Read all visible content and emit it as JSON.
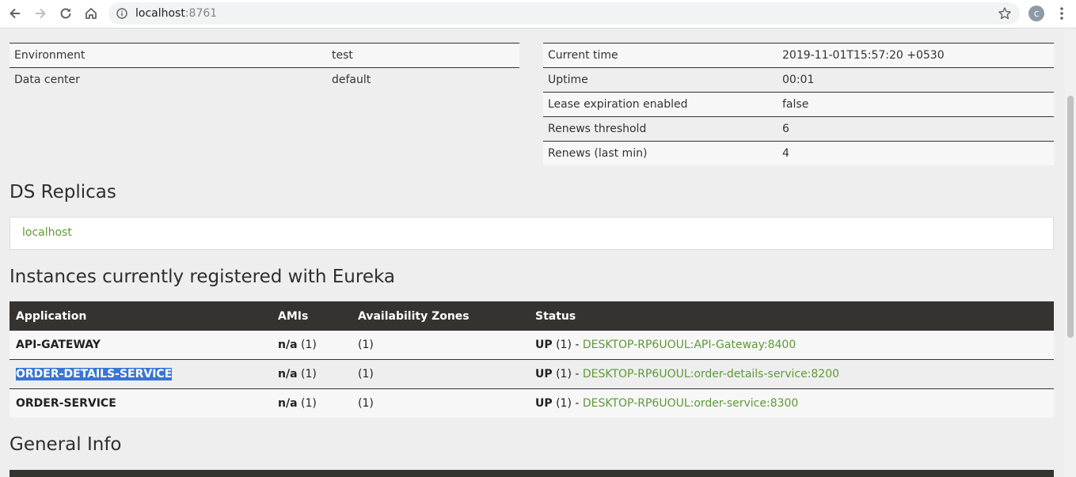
{
  "browser": {
    "url_host": "localhost",
    "url_port": ":8761",
    "profile_initial": "c"
  },
  "env_table": [
    {
      "key": "Environment",
      "value": "test"
    },
    {
      "key": "Data center",
      "value": "default"
    }
  ],
  "status_table": [
    {
      "key": "Current time",
      "value": "2019-11-01T15:57:20 +0530"
    },
    {
      "key": "Uptime",
      "value": "00:01"
    },
    {
      "key": "Lease expiration enabled",
      "value": "false"
    },
    {
      "key": "Renews threshold",
      "value": "6"
    },
    {
      "key": "Renews (last min)",
      "value": "4"
    }
  ],
  "replicas": {
    "title": "DS Replicas",
    "link": "localhost"
  },
  "instances": {
    "title": "Instances currently registered with Eureka",
    "columns": [
      "Application",
      "AMIs",
      "Availability Zones",
      "Status"
    ],
    "rows": [
      {
        "application": "API-GATEWAY",
        "amis_label": "n/a",
        "amis_count": " (1)",
        "zones": "(1)",
        "status_label": "UP",
        "status_count": " (1) - ",
        "instance": "DESKTOP-RP6UOUL:API-Gateway:8400"
      },
      {
        "application": "ORDER-DETAILS-SERVICE",
        "amis_label": "n/a",
        "amis_count": " (1)",
        "zones": "(1)",
        "status_label": "UP",
        "status_count": " (1) - ",
        "instance": "DESKTOP-RP6UOUL:order-details-service:8200"
      },
      {
        "application": "ORDER-SERVICE",
        "amis_label": "n/a",
        "amis_count": " (1)",
        "zones": "(1)",
        "status_label": "UP",
        "status_count": " (1) - ",
        "instance": "DESKTOP-RP6UOUL:order-service:8300"
      }
    ]
  },
  "general_info": {
    "title": "General Info"
  },
  "colors": {
    "header_bg": "#353330",
    "link": "#5d9a35",
    "selection": "#3875d7"
  }
}
